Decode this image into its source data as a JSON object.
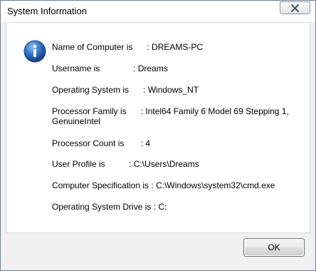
{
  "window": {
    "title": "System Information"
  },
  "icons": {
    "title_close": "close-icon",
    "message": "information-icon"
  },
  "info_lines": [
    "Name of Computer is      : DREAMS-PC",
    "Username is              : Dreams",
    "Operating System is      : Windows_NT",
    "Processor Family is      : Intel64 Family 6 Model 69 Stepping 1, GenuineIntel",
    "Processor Count is       : 4",
    "User Profile is          : C:\\Users\\Dreams",
    "Computer Specification is : C:\\Windows\\system32\\cmd.exe",
    "Operating System Drive is : C:"
  ],
  "buttons": {
    "ok_label": "OK"
  },
  "colors": {
    "close_glyph": "#4a5868",
    "info_icon_blue": "#2a66b8"
  }
}
